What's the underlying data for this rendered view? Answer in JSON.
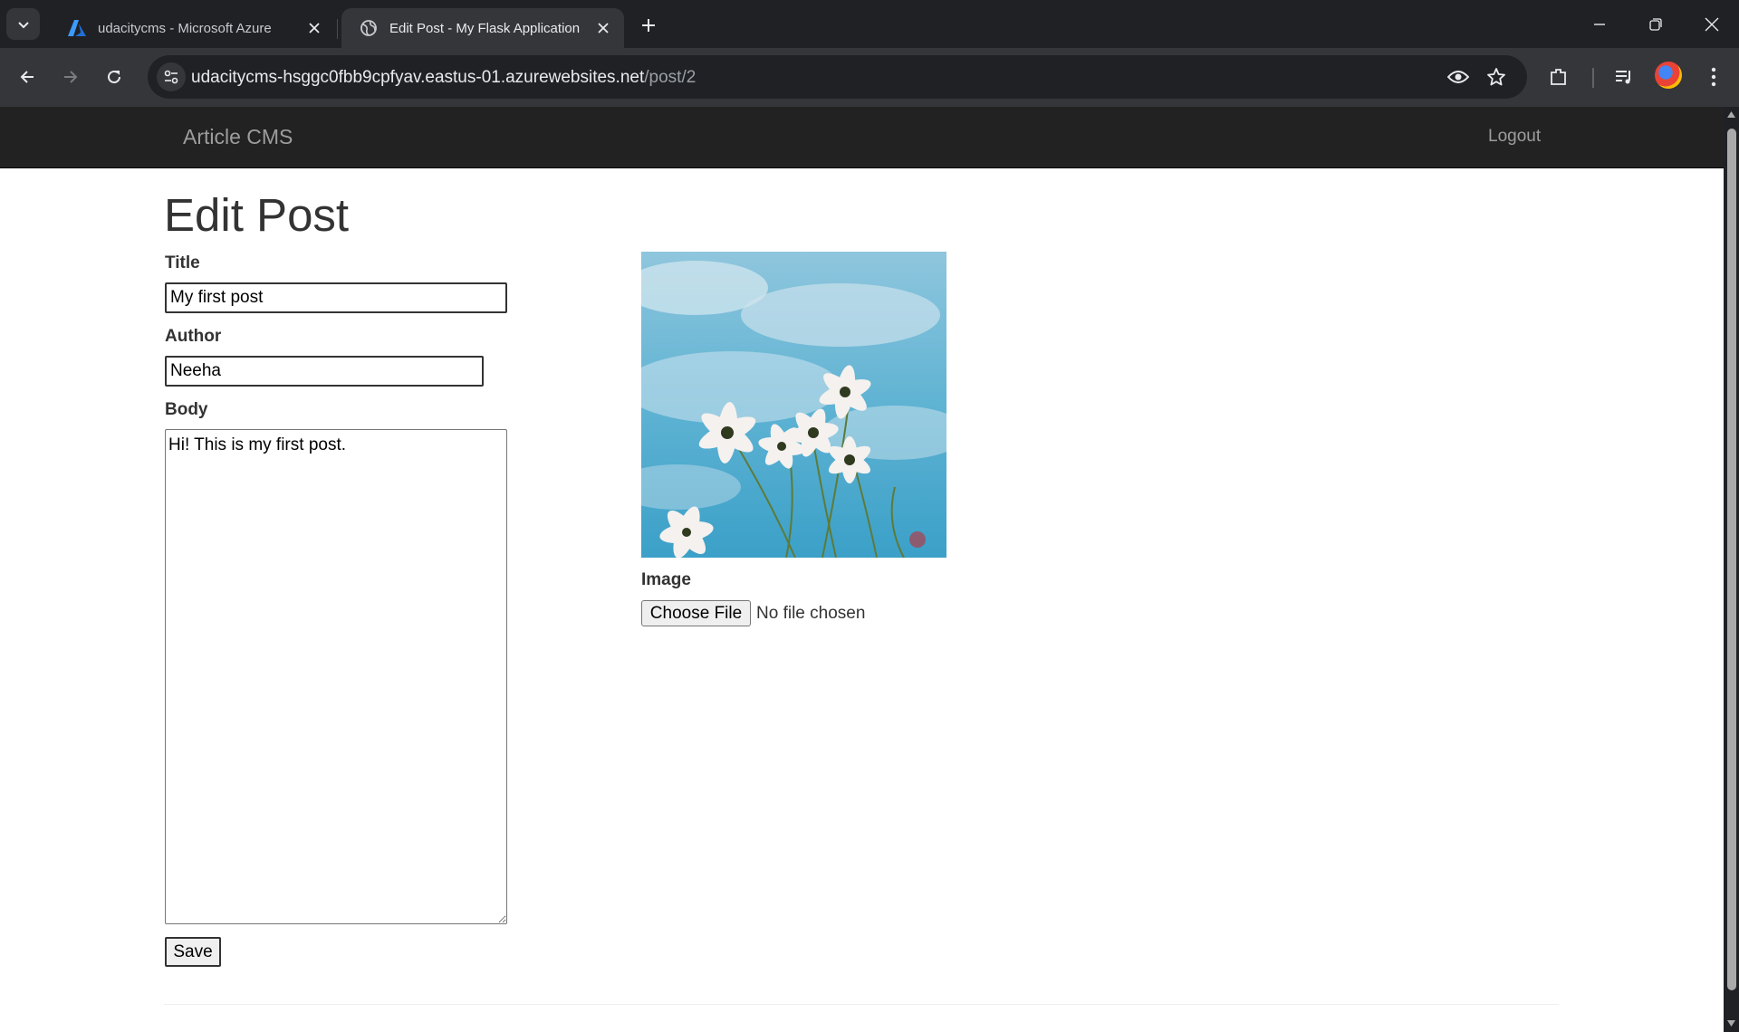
{
  "browser": {
    "tabs": [
      {
        "title": "udacitycms - Microsoft Azure",
        "icon": "azure-icon",
        "active": false
      },
      {
        "title": "Edit Post - My Flask Application",
        "icon": "globe-icon",
        "active": true
      }
    ],
    "url": {
      "host": "udacitycms-hsggc0fbb9cpfyav.eastus-01.azurewebsites.net",
      "path": "/post/2"
    },
    "colors": {
      "tabstrip": "#202124",
      "toolbar": "#35363a"
    }
  },
  "navbar": {
    "brand": "Article CMS",
    "logout": "Logout"
  },
  "form": {
    "heading": "Edit Post",
    "title_label": "Title",
    "title_value": "My first post",
    "author_label": "Author",
    "author_value": "Neeha",
    "body_label": "Body",
    "body_value": "Hi! This is my first post.",
    "save_label": "Save",
    "image_label": "Image",
    "choose_file_label": "Choose File",
    "file_status": "No file chosen"
  },
  "colors": {
    "navbar": "#222222",
    "navbar_text": "#9d9d9d",
    "text": "#333333"
  }
}
